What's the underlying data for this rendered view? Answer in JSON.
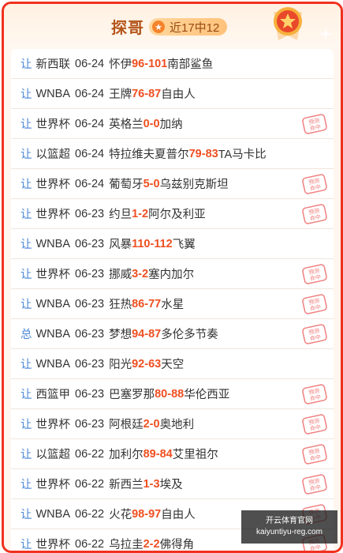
{
  "header": {
    "title": "探哥",
    "record_label": "近17中12"
  },
  "rows": [
    {
      "type": "让",
      "league": "新西联",
      "date": "06-24",
      "home": "怀伊",
      "home_score": "96",
      "away_score": "101",
      "away": "南部鲨鱼",
      "hit": false
    },
    {
      "type": "让",
      "league": "WNBA",
      "date": "06-24",
      "home": "王牌",
      "home_score": "76",
      "away_score": "87",
      "away": "自由人",
      "hit": false
    },
    {
      "type": "让",
      "league": "世界杯",
      "date": "06-24",
      "home": "英格兰",
      "home_score": "0",
      "away_score": "0",
      "away": "加纳",
      "hit": true
    },
    {
      "type": "让",
      "league": "以篮超",
      "date": "06-24",
      "home": "特拉维夫夏普尔",
      "home_score": "79",
      "away_score": "83",
      "away": "TA马卡比",
      "hit": false
    },
    {
      "type": "让",
      "league": "世界杯",
      "date": "06-24",
      "home": "葡萄牙",
      "home_score": "5",
      "away_score": "0",
      "away": "乌兹别克斯坦",
      "hit": true
    },
    {
      "type": "让",
      "league": "世界杯",
      "date": "06-23",
      "home": "约旦",
      "home_score": "1",
      "away_score": "2",
      "away": "阿尔及利亚",
      "hit": true
    },
    {
      "type": "让",
      "league": "WNBA",
      "date": "06-23",
      "home": "风暴",
      "home_score": "110",
      "away_score": "112",
      "away": "飞翼",
      "hit": false
    },
    {
      "type": "让",
      "league": "世界杯",
      "date": "06-23",
      "home": "挪威",
      "home_score": "3",
      "away_score": "2",
      "away": "塞内加尔",
      "hit": true
    },
    {
      "type": "让",
      "league": "WNBA",
      "date": "06-23",
      "home": "狂热",
      "home_score": "86",
      "away_score": "77",
      "away": "水星",
      "hit": true
    },
    {
      "type": "总",
      "league": "WNBA",
      "date": "06-23",
      "home": "梦想",
      "home_score": "94",
      "away_score": "87",
      "away": "多伦多节奏",
      "hit": true
    },
    {
      "type": "让",
      "league": "WNBA",
      "date": "06-23",
      "home": "阳光",
      "home_score": "92",
      "away_score": "63",
      "away": "天空",
      "hit": false
    },
    {
      "type": "让",
      "league": "西篮甲",
      "date": "06-23",
      "home": "巴塞罗那",
      "home_score": "80",
      "away_score": "88",
      "away": "华伦西亚",
      "hit": true
    },
    {
      "type": "让",
      "league": "世界杯",
      "date": "06-23",
      "home": "阿根廷",
      "home_score": "2",
      "away_score": "0",
      "away": "奥地利",
      "hit": true
    },
    {
      "type": "让",
      "league": "以篮超",
      "date": "06-22",
      "home": "加利尔",
      "home_score": "89",
      "away_score": "84",
      "away": "艾里祖尔",
      "hit": true
    },
    {
      "type": "让",
      "league": "世界杯",
      "date": "06-22",
      "home": "新西兰",
      "home_score": "1",
      "away_score": "3",
      "away": "埃及",
      "hit": true
    },
    {
      "type": "让",
      "league": "WNBA",
      "date": "06-22",
      "home": "火花",
      "home_score": "98",
      "away_score": "97",
      "away": "自由人",
      "hit": true
    },
    {
      "type": "让",
      "league": "世界杯",
      "date": "06-22",
      "home": "乌拉圭",
      "home_score": "2",
      "away_score": "2",
      "away": "佛得角",
      "hit": true
    }
  ],
  "stamp_text": "预测命中",
  "watermark": {
    "line1": "开云体育官网",
    "line2": "kaiyuntiyu-reg.com"
  },
  "colors": {
    "border": "#f0311f",
    "score": "#ef4f20",
    "type_label": "#4b87d6",
    "stamp": "#f08080"
  }
}
